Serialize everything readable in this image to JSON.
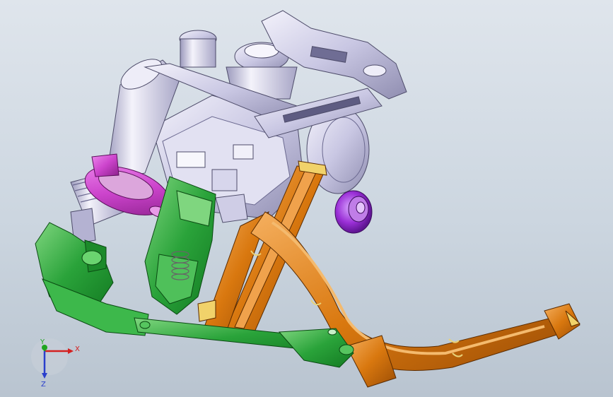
{
  "viewport": {
    "background_top": "#dfe5ec",
    "background_bottom": "#b9c4d0"
  },
  "colors": {
    "steel": "#c9c7e3",
    "steel_dark": "#8f8db0",
    "steel_light": "#eeedf8",
    "green": "#2aa33a",
    "green_dark": "#137a22",
    "green_light": "#7fd67f",
    "orange": "#d9780f",
    "orange_dark": "#9b4d05",
    "orange_light": "#f5b060",
    "magenta": "#cc44cc",
    "magenta_dark": "#8a1f8a",
    "purple": "#9a2fd6",
    "yellow": "#f1d26a",
    "axis_x": "#d42020",
    "axis_y": "#1fa51f",
    "axis_z": "#2a3fcc"
  },
  "triad": {
    "x_label": "X",
    "y_label": "Y",
    "z_label": "Z"
  }
}
